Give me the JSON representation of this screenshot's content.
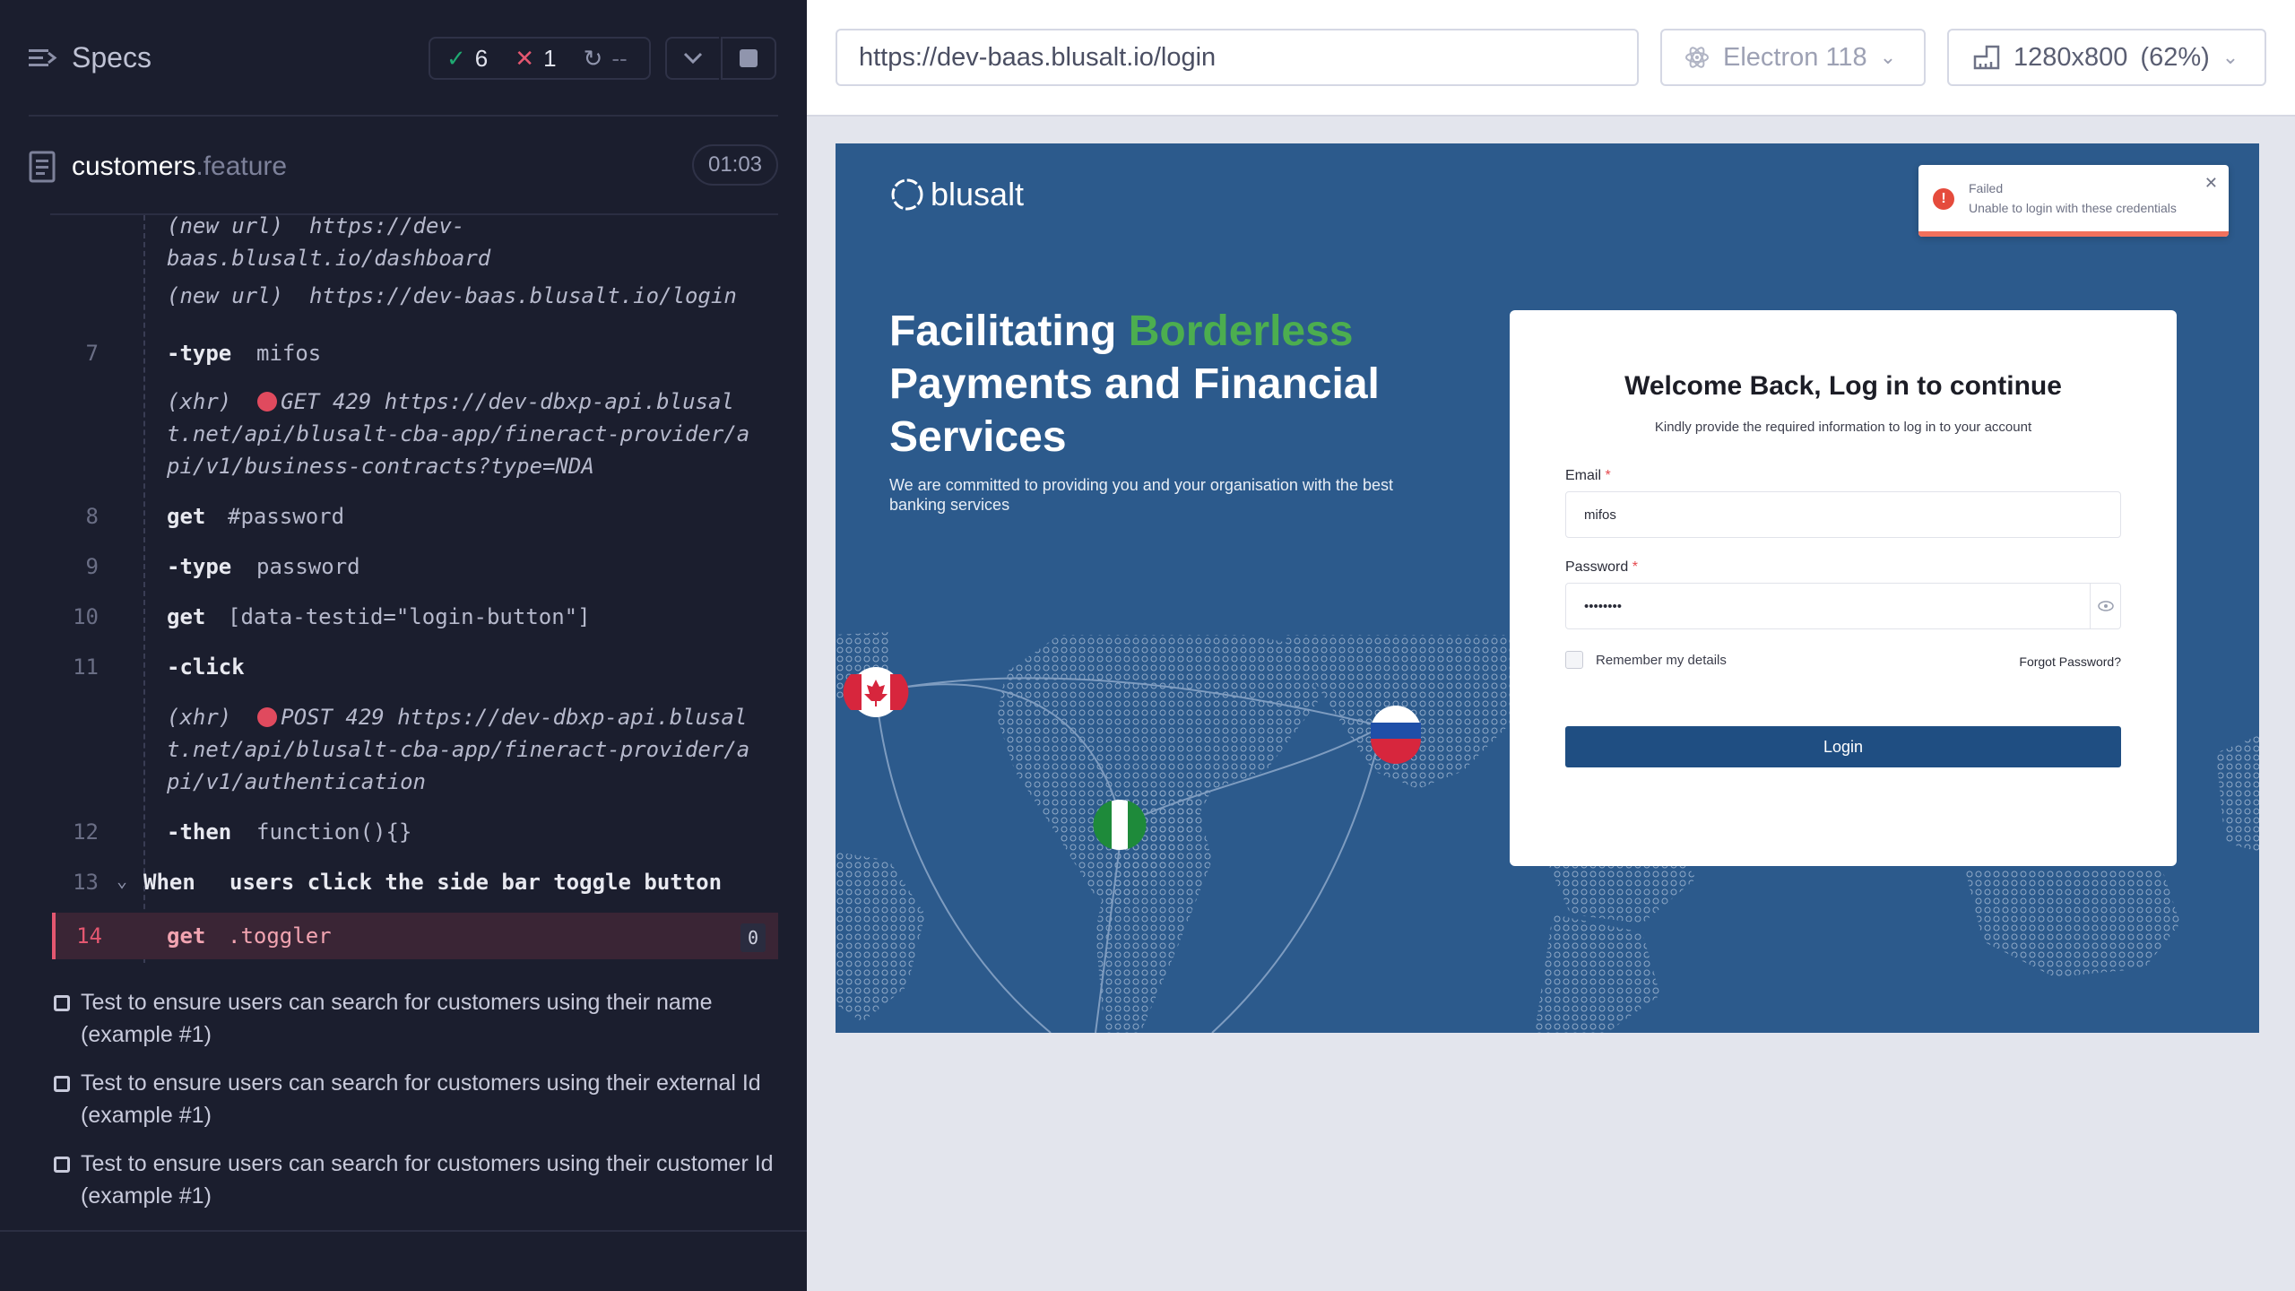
{
  "runner": {
    "specs_title": "Specs",
    "passed_count": "6",
    "failed_count": "1",
    "pending_label": "--",
    "file_name": "customers",
    "file_ext": ".feature",
    "duration": "01:03"
  },
  "commands": [
    {
      "type": "event",
      "line": "",
      "label": "(new url)",
      "text": "https://dev-baas.blusalt.io/dashboard"
    },
    {
      "type": "event",
      "line": "",
      "label": "(new url)",
      "text": "https://dev-baas.blusalt.io/login"
    },
    {
      "type": "cmd",
      "line": "7",
      "name": "-type",
      "arg": "mifos"
    },
    {
      "type": "xhr",
      "line": "",
      "label": "(xhr)",
      "text": "GET 429 https://dev-dbxp-api.blusalt.net/api/blusalt-cba-app/fineract-provider/api/v1/business-contracts?type=NDA"
    },
    {
      "type": "cmd",
      "line": "8",
      "name": "get",
      "arg": "#password"
    },
    {
      "type": "cmd",
      "line": "9",
      "name": "-type",
      "arg": "password"
    },
    {
      "type": "cmd",
      "line": "10",
      "name": "get",
      "arg": "[data-testid=\"login-button\"]"
    },
    {
      "type": "cmd",
      "line": "11",
      "name": "-click",
      "arg": ""
    },
    {
      "type": "xhr",
      "line": "",
      "label": "(xhr)",
      "text": "POST 429 https://dev-dbxp-api.blusalt.net/api/blusalt-cba-app/fineract-provider/api/v1/authentication"
    },
    {
      "type": "cmd",
      "line": "12",
      "name": "-then",
      "arg": "function(){}"
    },
    {
      "type": "when",
      "line": "13",
      "name": "When",
      "arg": "users click the side bar toggle button"
    },
    {
      "type": "active",
      "line": "14",
      "name": "get",
      "arg": ".toggler",
      "badge": "0"
    }
  ],
  "tests": [
    "Test to ensure users can search for customers using their name (example #1)",
    "Test to ensure users can search for customers using their external Id (example #1)",
    "Test to ensure users can search for customers using their customer Id (example #1)"
  ],
  "browser": {
    "url": "https://dev-baas.blusalt.io/login",
    "browser_name": "Electron 118",
    "viewport": "1280x800",
    "zoom": "(62%)"
  },
  "app": {
    "brand": "blusalt",
    "hero_prefix": "Facilitating ",
    "hero_accent": "Borderless",
    "hero_rest": "Payments and Financial Services",
    "hero_sub": "We are committed to providing you and your organisation with the best banking services",
    "toast_title": "Failed",
    "toast_msg": "Unable to login with these credentials",
    "card_title": "Welcome Back, Log in to continue",
    "card_sub": "Kindly provide the required information to log in to your account",
    "email_label": "Email",
    "email_value": "mifos",
    "password_label": "Password",
    "password_value": "••••••••",
    "remember_label": "Remember my details",
    "forgot_label": "Forgot Password?",
    "login_label": "Login",
    "required_mark": "*"
  },
  "colors": {
    "runner_bg": "#1b1e2e",
    "pass": "#1fa971",
    "fail": "#e45770",
    "app_bg": "#2c5a8c",
    "hero_accent": "#4cae4f",
    "login_button": "#1f4e82"
  }
}
